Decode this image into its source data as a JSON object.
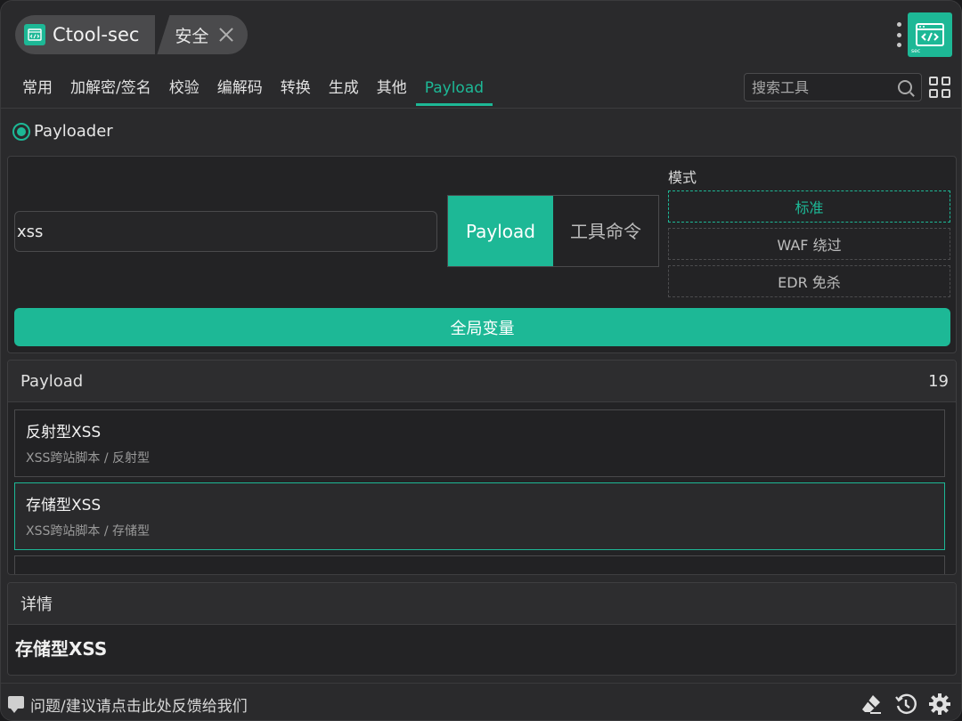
{
  "tab": {
    "title": "Ctool-sec",
    "tag": "安全"
  },
  "nav": {
    "items": [
      "常用",
      "加解密/签名",
      "校验",
      "编解码",
      "转换",
      "生成",
      "其他",
      "Payload"
    ],
    "active_index": 7,
    "search_placeholder": "搜索工具"
  },
  "tool": {
    "name": "Payloader"
  },
  "input": {
    "value": "xss"
  },
  "type_toggle": {
    "options": [
      "Payload",
      "工具命令"
    ],
    "selected": "Payload"
  },
  "mode": {
    "label": "模式",
    "options": [
      "标准",
      "WAF 绕过",
      "EDR 免杀"
    ],
    "selected": "标准"
  },
  "global_vars_button": "全局变量",
  "payload_list": {
    "header": "Payload",
    "count": "19",
    "items": [
      {
        "title": "反射型XSS",
        "subtitle": "XSS跨站脚本 / 反射型"
      },
      {
        "title": "存储型XSS",
        "subtitle": "XSS跨站脚本 / 存储型"
      }
    ],
    "selected_index": 1
  },
  "details": {
    "header": "详情",
    "title": "存储型XSS"
  },
  "footer": {
    "feedback": "问题/建议请点击此处反馈给我们"
  },
  "icons": {
    "logo": "code-window-icon",
    "close": "close-icon",
    "menu": "kebab-menu-icon",
    "search": "search-icon",
    "grid": "grid-icon",
    "chat": "chat-icon",
    "eraser": "eraser-icon",
    "history": "history-icon",
    "settings": "gear-icon"
  },
  "colors": {
    "accent": "#1db896",
    "background": "#2a2a2c",
    "panel": "#232325"
  }
}
